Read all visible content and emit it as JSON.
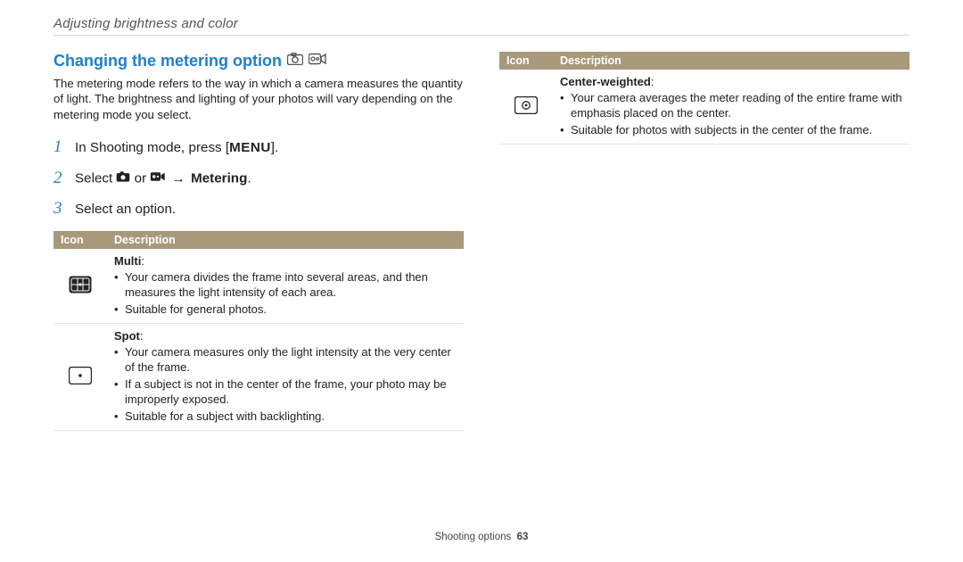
{
  "page": {
    "breadcrumb": "Adjusting brightness and color",
    "footer_section": "Shooting options",
    "footer_page": "63"
  },
  "heading": {
    "title": "Changing the metering option"
  },
  "intro": "The metering mode refers to the way in which a camera measures the quantity of light. The brightness and lighting of your photos will vary depending on the metering mode you select.",
  "steps": {
    "s1_num": "1",
    "s1_pre": "In Shooting mode, press [",
    "s1_menu": "MENU",
    "s1_post": "].",
    "s2_num": "2",
    "s2_pre": "Select ",
    "s2_mid": " or ",
    "s2_arrow": " → ",
    "s2_bold": "Metering",
    "s2_post": ".",
    "s3_num": "3",
    "s3_text": "Select an option."
  },
  "table_left": {
    "h_icon": "Icon",
    "h_desc": "Description",
    "rows": [
      {
        "title": "Multi",
        "title_suffix": ":",
        "bullets": [
          "Your camera divides the frame into several areas, and then measures the light intensity of each area.",
          "Suitable for general photos."
        ]
      },
      {
        "title": "Spot",
        "title_suffix": ":",
        "bullets": [
          "Your camera measures only the light intensity at the very center of the frame.",
          "If a subject is not in the center of the frame, your photo may be improperly exposed.",
          "Suitable for a subject with backlighting."
        ]
      }
    ]
  },
  "table_right": {
    "h_icon": "Icon",
    "h_desc": "Description",
    "rows": [
      {
        "title": "Center-weighted",
        "title_suffix": ":",
        "bullets": [
          "Your camera averages the meter reading of the entire frame with emphasis placed on the center.",
          "Suitable for photos with subjects in the center of the frame."
        ]
      }
    ]
  }
}
